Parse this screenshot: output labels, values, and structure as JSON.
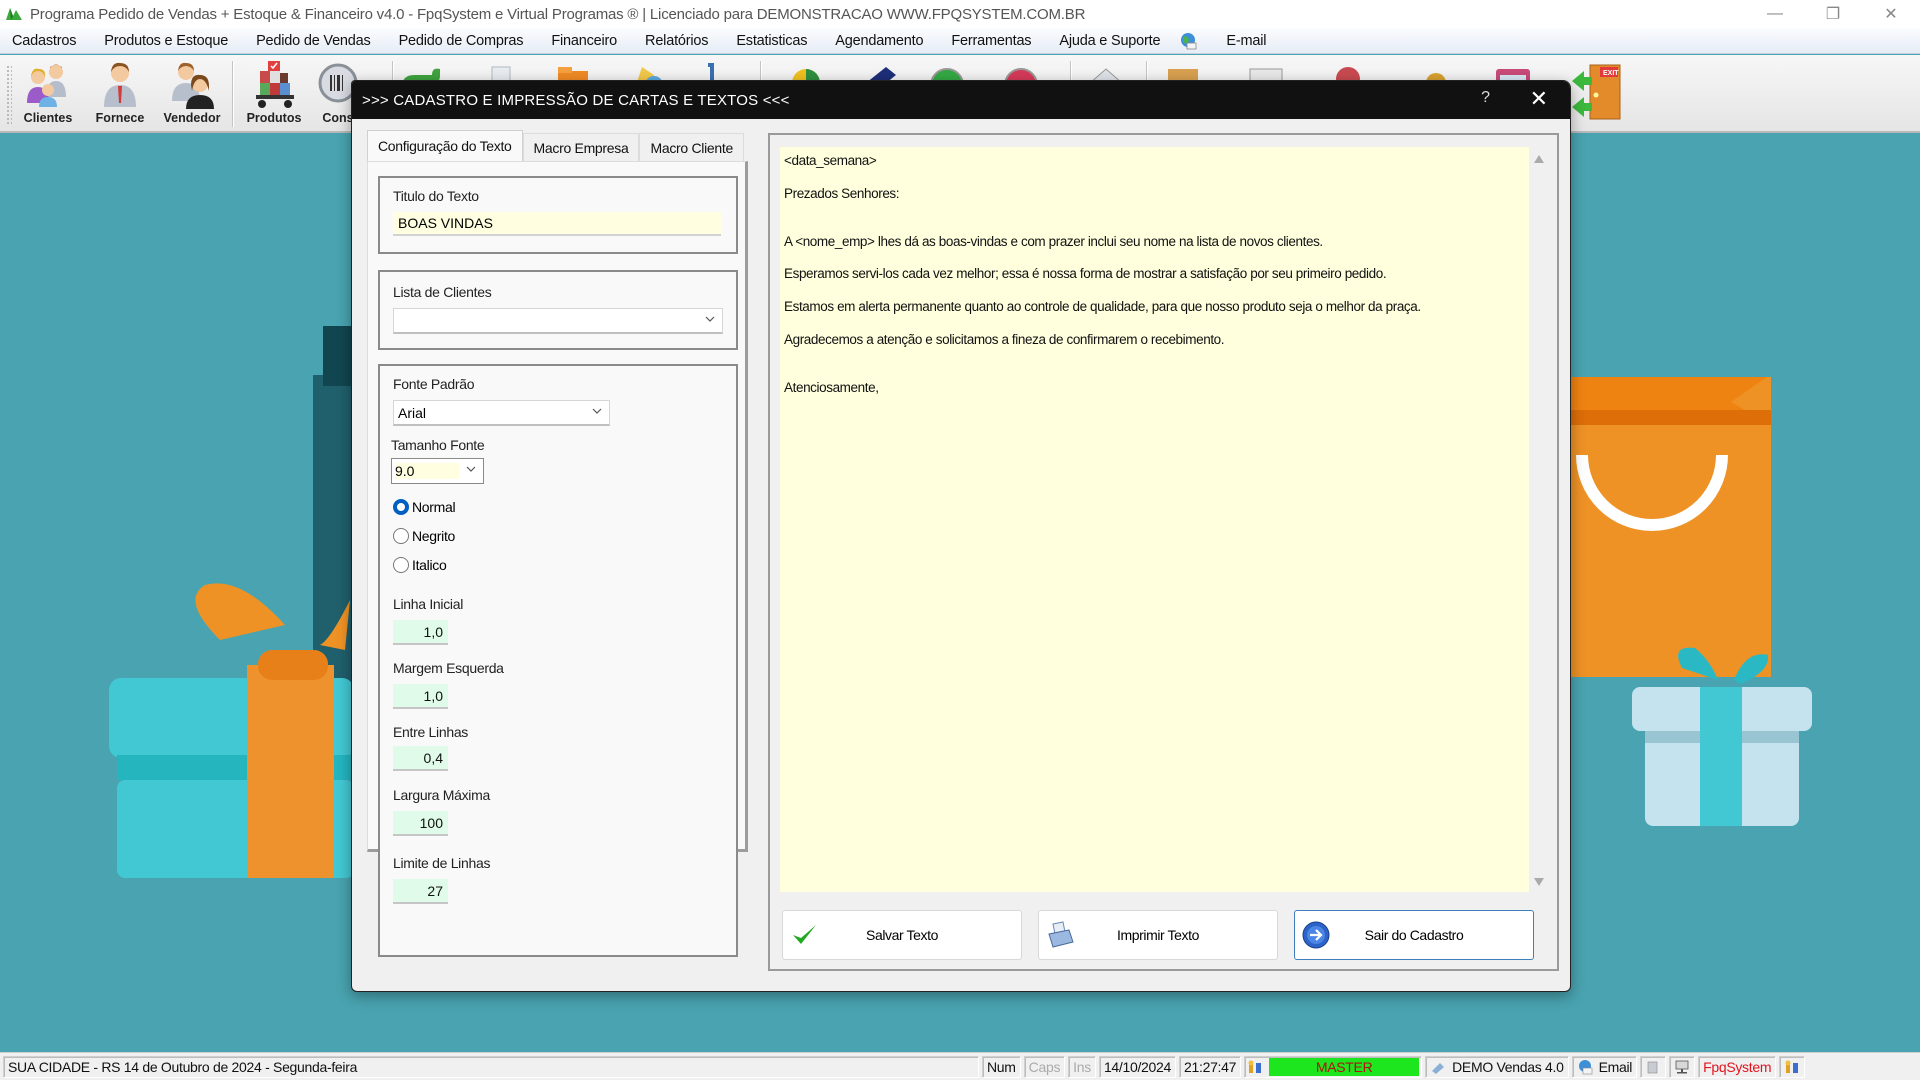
{
  "window": {
    "title": "Programa Pedido de Vendas + Estoque & Financeiro v4.0 - FpqSystem e Virtual Programas ® | Licenciado para  DEMONSTRACAO WWW.FPQSYSTEM.COM.BR",
    "controls": {
      "minimize": "—",
      "restore": "❐",
      "close": "✕"
    }
  },
  "menu": {
    "items": [
      "Cadastros",
      "Produtos e Estoque",
      "Pedido de Vendas",
      "Pedido de Compras",
      "Financeiro",
      "Relatórios",
      "Estatisticas",
      "Agendamento",
      "Ferramentas",
      "Ajuda e Suporte"
    ],
    "email": "E-mail"
  },
  "toolbar": {
    "buttons": [
      {
        "label": "Clientes",
        "icon": "clients-icon"
      },
      {
        "label": "Fornece",
        "icon": "supplier-icon"
      },
      {
        "label": "Vendedor",
        "icon": "seller-icon"
      },
      {
        "label": "Produtos",
        "icon": "products-cart-icon"
      },
      {
        "label": "Cons",
        "icon": "barcode-query-icon"
      }
    ]
  },
  "dialog": {
    "title": ">>>  CADASTRO E IMPRESSÃO DE CARTAS E TEXTOS  <<<",
    "help": "?",
    "close": "✕",
    "tabs": [
      "Configuração do Texto",
      "Macro Empresa",
      "Macro Cliente"
    ],
    "active_tab": 0,
    "form": {
      "titulo_label": "Titulo do Texto",
      "titulo_value": "BOAS VINDAS",
      "lista_label": "Lista de Clientes",
      "lista_value": "",
      "fonte_label": "Fonte Padrão",
      "fonte_value": "Arial",
      "tamanho_label": "Tamanho Fonte",
      "tamanho_value": "9.0",
      "styles": [
        {
          "label": "Normal",
          "checked": true
        },
        {
          "label": "Negrito",
          "checked": false
        },
        {
          "label": "Italico",
          "checked": false
        }
      ],
      "linha_inicial_label": "Linha Inicial",
      "linha_inicial_value": "1,0",
      "margem_label": "Margem Esquerda",
      "margem_value": "1,0",
      "entre_label": "Entre Linhas",
      "entre_value": "0,4",
      "largura_label": "Largura Máxima",
      "largura_value": "100",
      "limite_label": "Limite de Linhas",
      "limite_value": "27"
    },
    "editor_lines": [
      "<data_semana>",
      "Prezados Senhores:",
      "",
      "A <nome_emp> lhes dá as boas-vindas e com prazer inclui seu nome na lista de novos clientes.",
      "Esperamos servi-los cada vez melhor; essa é nossa forma de mostrar a satisfação por seu primeiro pedido.",
      "Estamos em alerta permanente quanto ao controle de qualidade, para que nosso produto seja o melhor da praça.",
      "Agradecemos a atenção e solicitamos a fineza de confirmarem o recebimento.",
      "",
      "Atenciosamente,"
    ],
    "buttons": {
      "save": "Salvar Texto",
      "print": "Imprimir Texto",
      "exit": "Sair do Cadastro"
    }
  },
  "statusbar": {
    "location_date": "SUA CIDADE - RS 14 de Outubro de 2024 - Segunda-feira",
    "num": "Num",
    "caps": "Caps",
    "ins": "Ins",
    "date": "14/10/2024",
    "time": "21:27:47",
    "user": "MASTER",
    "product": "DEMO Vendas 4.0",
    "email": "Email",
    "brand": "FpqSystem"
  },
  "colors": {
    "background": "#49a3b0",
    "editor_bg": "#ffffde",
    "title_field_bg": "#fffee0",
    "numeric_field_bg": "#e0fbe9",
    "master_bar": "#1ee61e",
    "brand_red": "#e2141e",
    "dialog_header": "#111111"
  }
}
